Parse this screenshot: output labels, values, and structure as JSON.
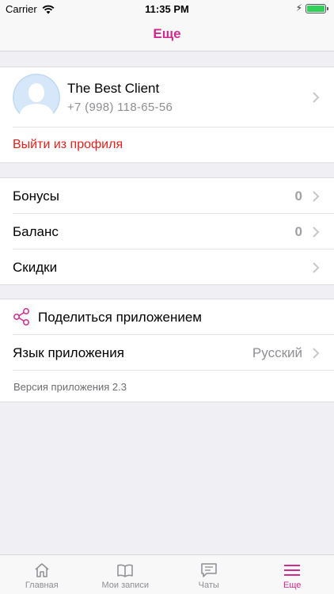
{
  "status_bar": {
    "carrier": "Carrier",
    "time": "11:35 PM"
  },
  "nav": {
    "title": "Еще"
  },
  "profile": {
    "name": "The Best Client",
    "phone": "+7 (998) 118-65-56",
    "logout_label": "Выйти из профиля"
  },
  "account": {
    "items": [
      {
        "label": "Бонусы",
        "value": "0"
      },
      {
        "label": "Баланс",
        "value": "0"
      },
      {
        "label": "Скидки",
        "value": ""
      }
    ]
  },
  "app": {
    "share_label": "Поделиться приложением",
    "language_label": "Язык приложения",
    "language_value": "Русский",
    "version_text": "Версия приложения 2.3"
  },
  "tabs": [
    {
      "label": "Главная",
      "icon": "home-icon"
    },
    {
      "label": "Мои записи",
      "icon": "book-icon"
    },
    {
      "label": "Чаты",
      "icon": "chat-icon"
    },
    {
      "label": "Еще",
      "icon": "menu-icon"
    }
  ],
  "colors": {
    "accent": "#d12a8c",
    "danger": "#e1211c",
    "secondary_text": "#8e8e93"
  }
}
